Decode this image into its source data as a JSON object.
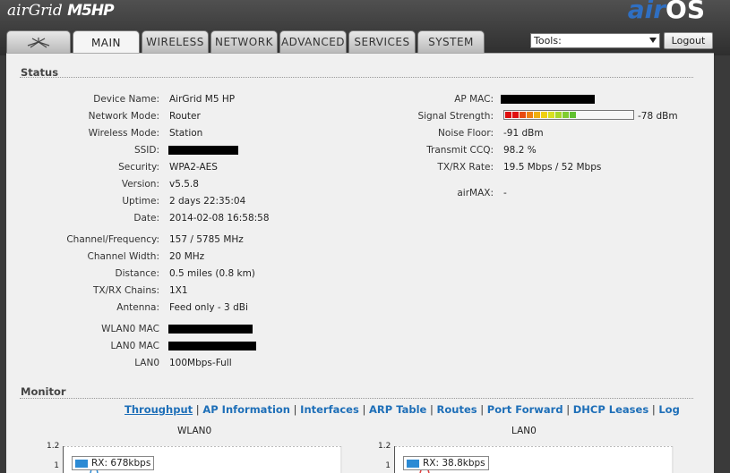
{
  "brand": {
    "product_prefix": "air",
    "product_name": "Grid",
    "product_model": "M5HP",
    "os_prefix": "air",
    "os_name": "OS"
  },
  "tabs": [
    {
      "id": "ubnt",
      "icon": "ubiquiti-logo-icon",
      "label": ""
    },
    {
      "id": "main",
      "label": "MAIN"
    },
    {
      "id": "wireless",
      "label": "WIRELESS"
    },
    {
      "id": "network",
      "label": "NETWORK"
    },
    {
      "id": "advanced",
      "label": "ADVANCED"
    },
    {
      "id": "services",
      "label": "SERVICES"
    },
    {
      "id": "system",
      "label": "SYSTEM"
    }
  ],
  "active_tab": "main",
  "header": {
    "tools_label": "Tools:",
    "logout_label": "Logout"
  },
  "status": {
    "title": "Status",
    "left": [
      {
        "label": "Device Name:",
        "value": "AirGrid M5 HP"
      },
      {
        "label": "Network Mode:",
        "value": "Router"
      },
      {
        "label": "Wireless Mode:",
        "value": "Station"
      },
      {
        "label": "SSID:",
        "value": ""
      },
      {
        "label": "Security:",
        "value": "WPA2-AES"
      },
      {
        "label": "Version:",
        "value": "v5.5.8"
      },
      {
        "label": "Uptime:",
        "value": "2 days 22:35:04"
      },
      {
        "label": "Date:",
        "value": "2014-02-08 16:58:58"
      },
      {
        "label": "Channel/Frequency:",
        "value": "157 / 5785 MHz"
      },
      {
        "label": "Channel Width:",
        "value": "20 MHz"
      },
      {
        "label": "Distance:",
        "value": "0.5 miles (0.8 km)"
      },
      {
        "label": "TX/RX Chains:",
        "value": "1X1"
      },
      {
        "label": "Antenna:",
        "value": "Feed only - 3 dBi"
      },
      {
        "label": "WLAN0 MAC",
        "value": ""
      },
      {
        "label": "LAN0 MAC",
        "value": ""
      },
      {
        "label": "LAN0",
        "value": "100Mbps-Full"
      }
    ],
    "right": [
      {
        "label": "AP MAC:",
        "value": ""
      },
      {
        "label": "Signal Strength:",
        "value": "-78 dBm"
      },
      {
        "label": "Noise Floor:",
        "value": "-91 dBm"
      },
      {
        "label": "Transmit CCQ:",
        "value": "98.2 %"
      },
      {
        "label": "TX/RX Rate:",
        "value": "19.5 Mbps / 52 Mbps"
      },
      {
        "label": "airMAX:",
        "value": "-"
      }
    ],
    "signal_level_fraction": 0.62,
    "signal_colors": [
      "#e01010",
      "#e01010",
      "#e84a10",
      "#f08010",
      "#f0b010",
      "#f0d010",
      "#d8e020",
      "#a8d828",
      "#80cc30",
      "#60c030"
    ]
  },
  "monitor": {
    "title": "Monitor",
    "links": [
      {
        "label": "Throughput",
        "current": true
      },
      {
        "label": "AP Information"
      },
      {
        "label": "Interfaces"
      },
      {
        "label": "ARP Table"
      },
      {
        "label": "Routes"
      },
      {
        "label": "Port Forward"
      },
      {
        "label": "DHCP Leases"
      },
      {
        "label": "Log"
      }
    ],
    "graphs": [
      {
        "title": "WLAN0",
        "y_ticks": [
          "1.2",
          "1"
        ],
        "legend": "RX: 678kbps",
        "legend_color": "#2c8ad4"
      },
      {
        "title": "LAN0",
        "y_ticks": [
          "1.2",
          "1"
        ],
        "legend": "RX: 38.8kbps",
        "legend_color": "#2c8ad4"
      }
    ]
  }
}
